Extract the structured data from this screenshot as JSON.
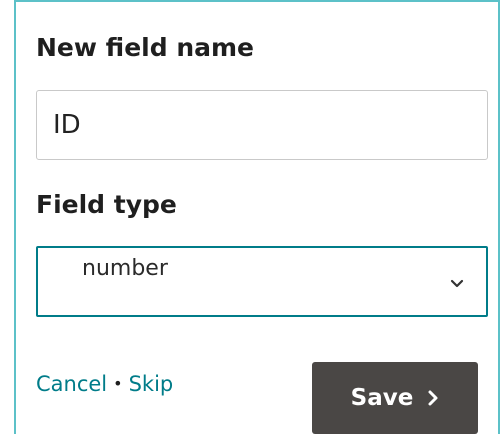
{
  "form": {
    "field_name_label": "New field name",
    "field_name_value": "ID",
    "field_type_label": "Field type",
    "field_type_selected": "number"
  },
  "actions": {
    "cancel_label": "Cancel",
    "separator": "•",
    "skip_label": "Skip",
    "save_label": "Save"
  },
  "icons": {
    "select_chevron": "chevron-down-icon",
    "save_arrow": "chevron-right-icon"
  },
  "colors": {
    "panel_border": "#5cc1c8",
    "accent_teal": "#007c89",
    "save_button_bg": "#4a4745"
  }
}
